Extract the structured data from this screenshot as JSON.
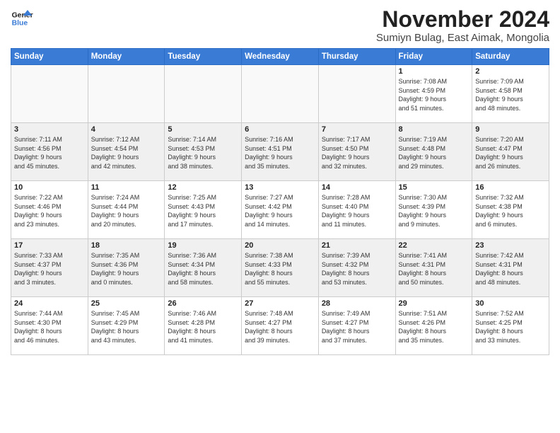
{
  "header": {
    "logo_line1": "General",
    "logo_line2": "Blue",
    "month": "November 2024",
    "location": "Sumiyn Bulag, East Aimak, Mongolia"
  },
  "weekdays": [
    "Sunday",
    "Monday",
    "Tuesday",
    "Wednesday",
    "Thursday",
    "Friday",
    "Saturday"
  ],
  "weeks": [
    [
      {
        "day": "",
        "info": "",
        "empty": true
      },
      {
        "day": "",
        "info": "",
        "empty": true
      },
      {
        "day": "",
        "info": "",
        "empty": true
      },
      {
        "day": "",
        "info": "",
        "empty": true
      },
      {
        "day": "",
        "info": "",
        "empty": true
      },
      {
        "day": "1",
        "info": "Sunrise: 7:08 AM\nSunset: 4:59 PM\nDaylight: 9 hours\nand 51 minutes."
      },
      {
        "day": "2",
        "info": "Sunrise: 7:09 AM\nSunset: 4:58 PM\nDaylight: 9 hours\nand 48 minutes."
      }
    ],
    [
      {
        "day": "3",
        "info": "Sunrise: 7:11 AM\nSunset: 4:56 PM\nDaylight: 9 hours\nand 45 minutes.",
        "shaded": true
      },
      {
        "day": "4",
        "info": "Sunrise: 7:12 AM\nSunset: 4:54 PM\nDaylight: 9 hours\nand 42 minutes.",
        "shaded": true
      },
      {
        "day": "5",
        "info": "Sunrise: 7:14 AM\nSunset: 4:53 PM\nDaylight: 9 hours\nand 38 minutes.",
        "shaded": true
      },
      {
        "day": "6",
        "info": "Sunrise: 7:16 AM\nSunset: 4:51 PM\nDaylight: 9 hours\nand 35 minutes.",
        "shaded": true
      },
      {
        "day": "7",
        "info": "Sunrise: 7:17 AM\nSunset: 4:50 PM\nDaylight: 9 hours\nand 32 minutes.",
        "shaded": true
      },
      {
        "day": "8",
        "info": "Sunrise: 7:19 AM\nSunset: 4:48 PM\nDaylight: 9 hours\nand 29 minutes.",
        "shaded": true
      },
      {
        "day": "9",
        "info": "Sunrise: 7:20 AM\nSunset: 4:47 PM\nDaylight: 9 hours\nand 26 minutes.",
        "shaded": true
      }
    ],
    [
      {
        "day": "10",
        "info": "Sunrise: 7:22 AM\nSunset: 4:46 PM\nDaylight: 9 hours\nand 23 minutes."
      },
      {
        "day": "11",
        "info": "Sunrise: 7:24 AM\nSunset: 4:44 PM\nDaylight: 9 hours\nand 20 minutes."
      },
      {
        "day": "12",
        "info": "Sunrise: 7:25 AM\nSunset: 4:43 PM\nDaylight: 9 hours\nand 17 minutes."
      },
      {
        "day": "13",
        "info": "Sunrise: 7:27 AM\nSunset: 4:42 PM\nDaylight: 9 hours\nand 14 minutes."
      },
      {
        "day": "14",
        "info": "Sunrise: 7:28 AM\nSunset: 4:40 PM\nDaylight: 9 hours\nand 11 minutes."
      },
      {
        "day": "15",
        "info": "Sunrise: 7:30 AM\nSunset: 4:39 PM\nDaylight: 9 hours\nand 9 minutes."
      },
      {
        "day": "16",
        "info": "Sunrise: 7:32 AM\nSunset: 4:38 PM\nDaylight: 9 hours\nand 6 minutes."
      }
    ],
    [
      {
        "day": "17",
        "info": "Sunrise: 7:33 AM\nSunset: 4:37 PM\nDaylight: 9 hours\nand 3 minutes.",
        "shaded": true
      },
      {
        "day": "18",
        "info": "Sunrise: 7:35 AM\nSunset: 4:36 PM\nDaylight: 9 hours\nand 0 minutes.",
        "shaded": true
      },
      {
        "day": "19",
        "info": "Sunrise: 7:36 AM\nSunset: 4:34 PM\nDaylight: 8 hours\nand 58 minutes.",
        "shaded": true
      },
      {
        "day": "20",
        "info": "Sunrise: 7:38 AM\nSunset: 4:33 PM\nDaylight: 8 hours\nand 55 minutes.",
        "shaded": true
      },
      {
        "day": "21",
        "info": "Sunrise: 7:39 AM\nSunset: 4:32 PM\nDaylight: 8 hours\nand 53 minutes.",
        "shaded": true
      },
      {
        "day": "22",
        "info": "Sunrise: 7:41 AM\nSunset: 4:31 PM\nDaylight: 8 hours\nand 50 minutes.",
        "shaded": true
      },
      {
        "day": "23",
        "info": "Sunrise: 7:42 AM\nSunset: 4:31 PM\nDaylight: 8 hours\nand 48 minutes.",
        "shaded": true
      }
    ],
    [
      {
        "day": "24",
        "info": "Sunrise: 7:44 AM\nSunset: 4:30 PM\nDaylight: 8 hours\nand 46 minutes."
      },
      {
        "day": "25",
        "info": "Sunrise: 7:45 AM\nSunset: 4:29 PM\nDaylight: 8 hours\nand 43 minutes."
      },
      {
        "day": "26",
        "info": "Sunrise: 7:46 AM\nSunset: 4:28 PM\nDaylight: 8 hours\nand 41 minutes."
      },
      {
        "day": "27",
        "info": "Sunrise: 7:48 AM\nSunset: 4:27 PM\nDaylight: 8 hours\nand 39 minutes."
      },
      {
        "day": "28",
        "info": "Sunrise: 7:49 AM\nSunset: 4:27 PM\nDaylight: 8 hours\nand 37 minutes."
      },
      {
        "day": "29",
        "info": "Sunrise: 7:51 AM\nSunset: 4:26 PM\nDaylight: 8 hours\nand 35 minutes."
      },
      {
        "day": "30",
        "info": "Sunrise: 7:52 AM\nSunset: 4:25 PM\nDaylight: 8 hours\nand 33 minutes."
      }
    ]
  ]
}
